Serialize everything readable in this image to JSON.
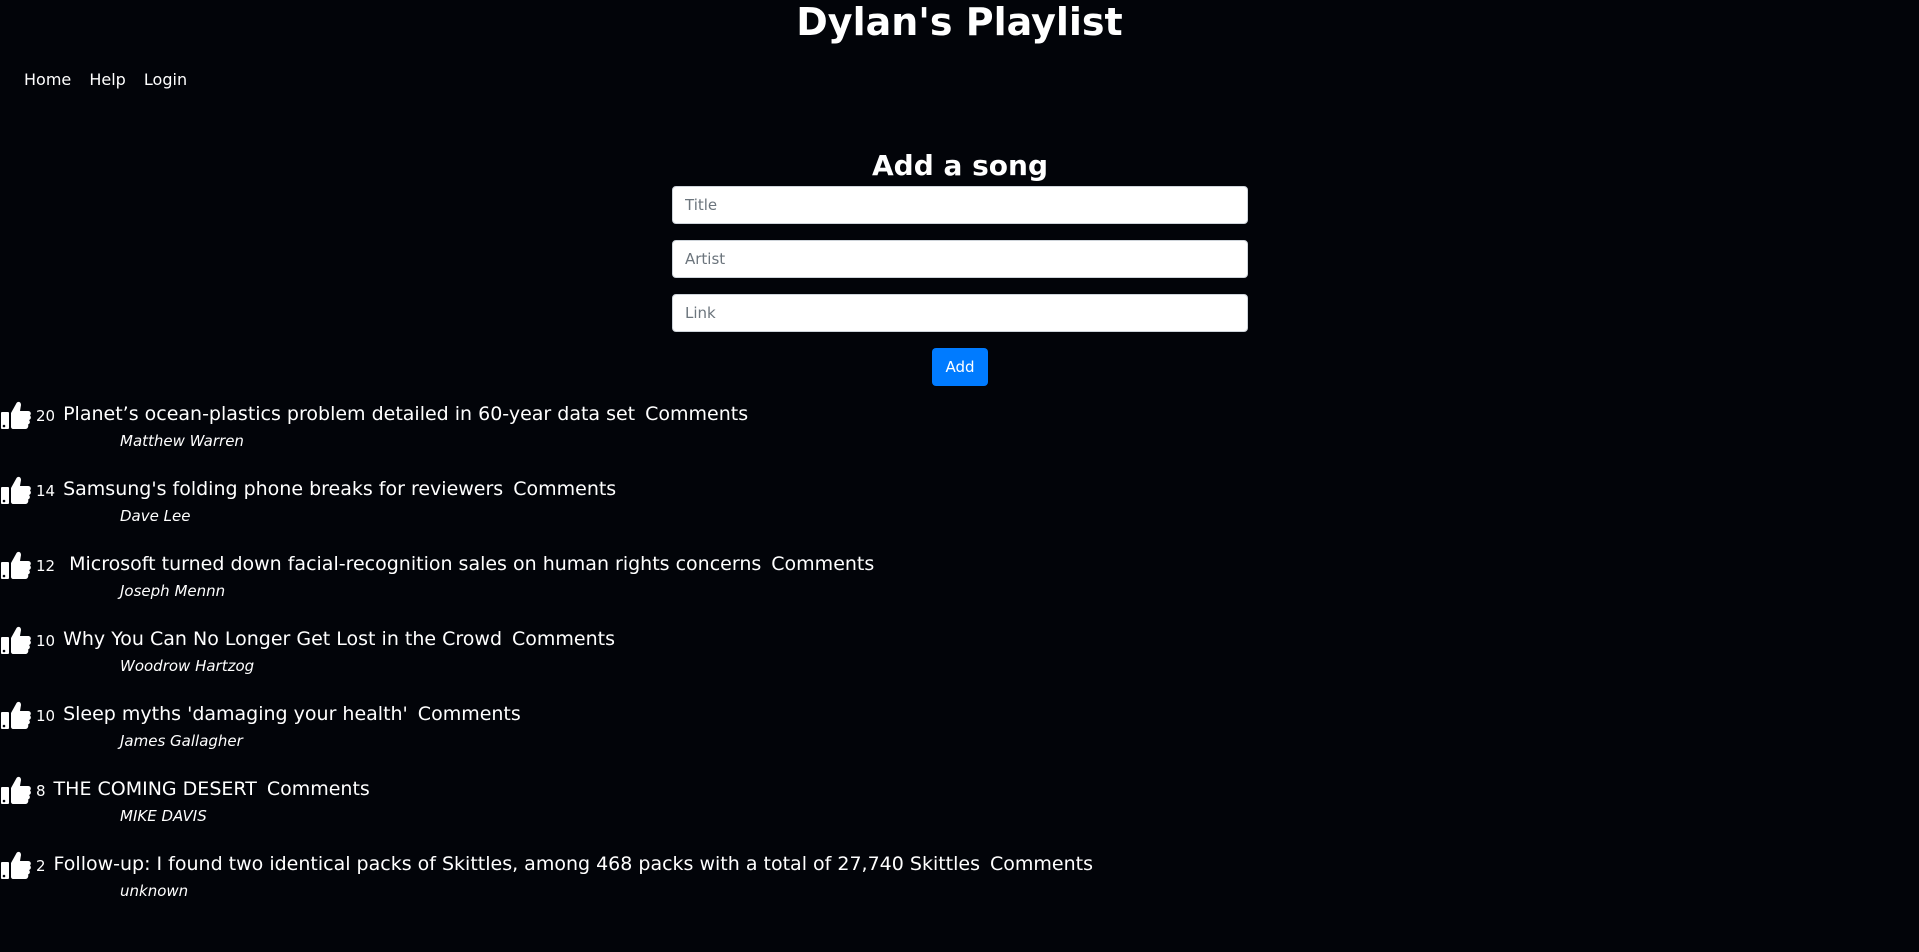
{
  "header": {
    "title": "Dylan's Playlist"
  },
  "nav": {
    "home": "Home",
    "help": "Help",
    "login": "Login"
  },
  "form": {
    "heading": "Add a song",
    "title_placeholder": "Title",
    "artist_placeholder": "Artist",
    "link_placeholder": "Link",
    "add_label": "Add"
  },
  "colors": {
    "background": "#020409",
    "accent": "#007bff"
  },
  "icons": {
    "like": "thumbs-up-icon"
  },
  "songs": [
    {
      "likes": "20",
      "title": "Planet’s ocean-plastics problem detailed in 60-year data set",
      "comments": "Comments",
      "artist": "Matthew Warren"
    },
    {
      "likes": "14",
      "title": "Samsung's folding phone breaks for reviewers",
      "comments": "Comments",
      "artist": "Dave Lee"
    },
    {
      "likes": "12",
      "title": " Microsoft turned down facial-recognition sales on human rights concerns",
      "comments": "Comments",
      "artist": "Joseph Mennn"
    },
    {
      "likes": "10",
      "title": "Why You Can No Longer Get Lost in the Crowd",
      "comments": "Comments",
      "artist": "Woodrow Hartzog"
    },
    {
      "likes": "10",
      "title": "Sleep myths 'damaging your health'",
      "comments": "Comments",
      "artist": "James Gallagher"
    },
    {
      "likes": "8",
      "title": "THE COMING DESERT",
      "comments": "Comments",
      "artist": "MIKE DAVIS"
    },
    {
      "likes": "2",
      "title": "Follow-up: I found two identical packs of Skittles, among 468 packs with a total of 27,740 Skittles",
      "comments": "Comments",
      "artist": "unknown"
    }
  ]
}
